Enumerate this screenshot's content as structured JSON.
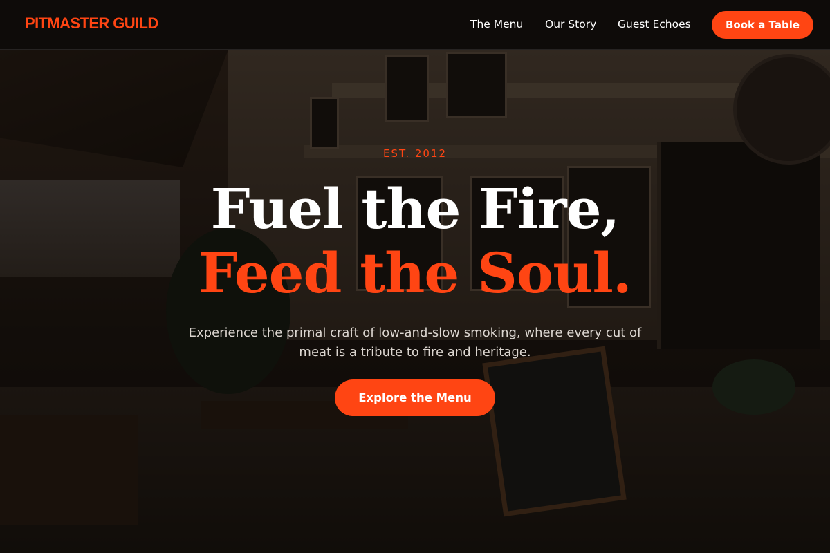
{
  "header": {
    "brand": "PITMASTER GUILD",
    "nav": {
      "menu": "The Menu",
      "story": "Our Story",
      "echoes": "Guest Echoes"
    },
    "cta": "Book a Table"
  },
  "hero": {
    "eyebrow": "EST. 2012",
    "headline_line1": "Fuel the Fire,",
    "headline_line2": "Feed the Soul.",
    "subtext": "Experience the primal craft of low-and-slow smoking, where every cut of meat is a tribute to fire and heritage.",
    "cta": "Explore the Menu"
  },
  "colors": {
    "accent": "#ff4513",
    "header_bg": "#0c0a09",
    "text_light": "#ffffff"
  }
}
